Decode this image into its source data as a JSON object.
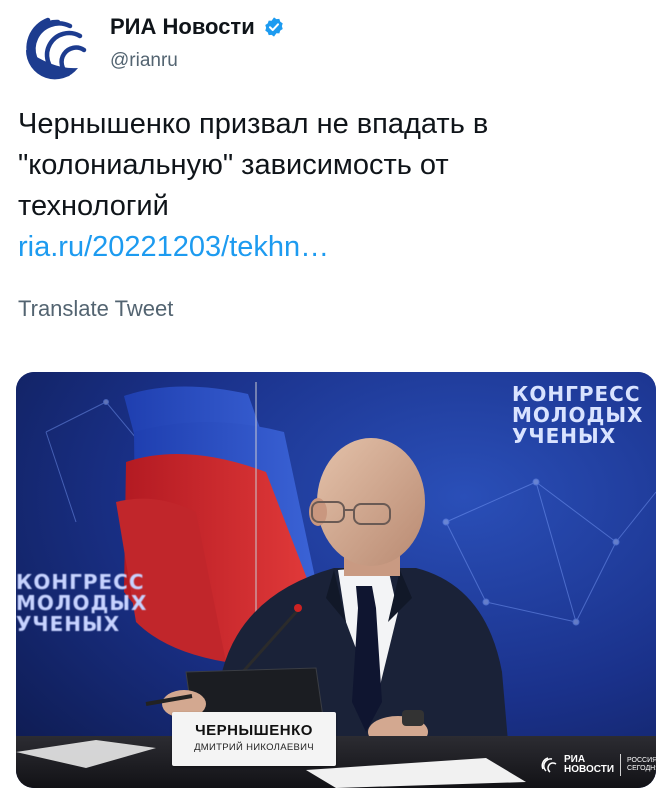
{
  "author": {
    "display_name": "РИА Новости",
    "handle": "@rianru",
    "avatar_icon": "ria-globe-logo-icon",
    "verified_icon": "verified-badge-icon",
    "brand_color": "#1d3c8f",
    "verified_color": "#1d9bf0"
  },
  "tweet": {
    "text_line_1": "Чернышенко призвал не впадать в",
    "text_line_2": "\"колониальную\" зависимость от",
    "text_line_3": "технологий",
    "link_text": "ria.ru/20221203/tekhn…",
    "translate_label": "Translate Tweet",
    "link_color": "#1d9bf0"
  },
  "media": {
    "backdrop_text_right_1": "КОНГРЕСС",
    "backdrop_text_right_2": "МОЛОДЫХ",
    "backdrop_text_right_3": "УЧЕНЫХ",
    "backdrop_text_left_1": "КОНГРЕСС",
    "backdrop_text_left_2": "МОЛОДЫХ",
    "backdrop_text_left_3": "УЧЕНЫХ",
    "nameplate_name": "ЧЕРНЫШЕНКО",
    "nameplate_sub": "ДМИТРИЙ НИКОЛАЕВИЧ",
    "watermark_line_1": "РИА",
    "watermark_line_2": "НОВОСТИ",
    "watermark_line_3": "РОССИЯ",
    "watermark_line_4": "СЕГОДНЯ"
  }
}
